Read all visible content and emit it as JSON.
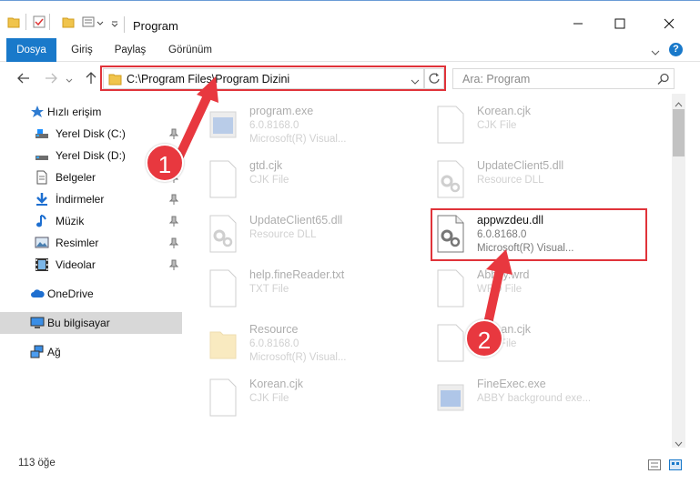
{
  "window": {
    "title": "Program",
    "help_label": "?"
  },
  "ribbon": {
    "tabs": [
      {
        "label": "Dosya",
        "active": true
      },
      {
        "label": "Giriş",
        "active": false
      },
      {
        "label": "Paylaş",
        "active": false
      },
      {
        "label": "Görünüm",
        "active": false
      }
    ]
  },
  "address": {
    "path": "C:\\Program Files\\Program Dizini",
    "search_placeholder": "Ara: Program"
  },
  "sidebar": {
    "quick_access": "Hızlı erişim",
    "items": [
      {
        "label": "Yerel Disk (C:)",
        "icon": "drive-icon",
        "pinned": true
      },
      {
        "label": "Yerel Disk (D:)",
        "icon": "drive-icon",
        "pinned": false
      },
      {
        "label": "Belgeler",
        "icon": "documents-icon",
        "pinned": true
      },
      {
        "label": "İndirmeler",
        "icon": "downloads-icon",
        "pinned": true
      },
      {
        "label": "Müzik",
        "icon": "music-icon",
        "pinned": true
      },
      {
        "label": "Resimler",
        "icon": "pictures-icon",
        "pinned": true
      },
      {
        "label": "Videolar",
        "icon": "videos-icon",
        "pinned": true
      }
    ],
    "onedrive": "OneDrive",
    "this_pc": "Bu bilgisayar",
    "network": "Ağ"
  },
  "files": [
    {
      "name": "program.exe",
      "line2": "6.0.8168.0",
      "line3": "Microsoft(R) Visual...",
      "icon": "exe-icon",
      "faded": true
    },
    {
      "name": "Korean.cjk",
      "line2": "CJK File",
      "line3": "",
      "icon": "file-icon",
      "faded": true
    },
    {
      "name": "gtd.cjk",
      "line2": "CJK File",
      "line3": "",
      "icon": "file-icon",
      "faded": true
    },
    {
      "name": "UpdateClient5.dll",
      "line2": "Resource DLL",
      "line3": "",
      "icon": "dll-icon",
      "faded": true
    },
    {
      "name": "UpdateClient65.dll",
      "line2": "Resource DLL",
      "line3": "",
      "icon": "dll-icon",
      "faded": true
    },
    {
      "name": "appwzdeu.dll",
      "line2": "6.0.8168.0",
      "line3": "Microsoft(R) Visual...",
      "icon": "dll-icon",
      "faded": false
    },
    {
      "name": "help.fineReader.txt",
      "line2": "TXT File",
      "line3": "",
      "icon": "file-icon",
      "faded": true
    },
    {
      "name": "Abbyy.wrd",
      "line2": "WRD File",
      "line3": "",
      "icon": "file-icon",
      "faded": true
    },
    {
      "name": "Resource",
      "line2": "6.0.8168.0",
      "line3": "Microsoft(R) Visual...",
      "icon": "folder-icon",
      "faded": true
    },
    {
      "name": "Korean.cjk",
      "line2": "CJK File",
      "line3": "",
      "icon": "file-icon",
      "faded": true
    },
    {
      "name": "Korean.cjk",
      "line2": "CJK File",
      "line3": "",
      "icon": "file-icon",
      "faded": true
    },
    {
      "name": "FineExec.exe",
      "line2": "ABBY background exe...",
      "line3": "",
      "icon": "exe-icon",
      "faded": true
    }
  ],
  "status": {
    "count": "113 öğe"
  },
  "annotations": {
    "marker1": "1",
    "marker2": "2",
    "color": "#e8383f"
  }
}
